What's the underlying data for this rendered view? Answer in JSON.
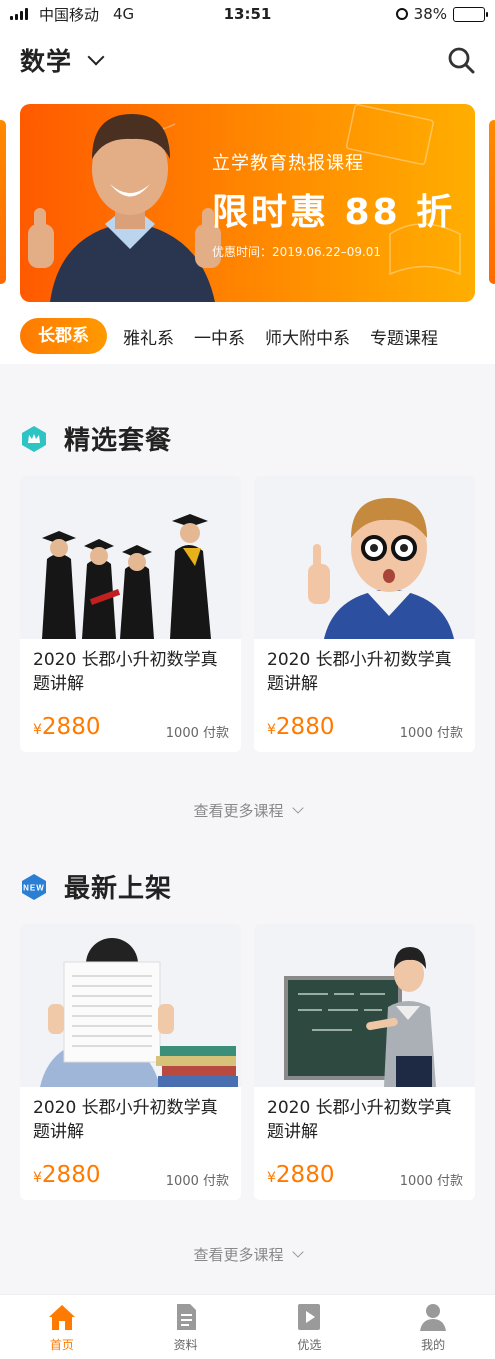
{
  "status_bar": {
    "carrier": "中国移动",
    "network": "4G",
    "time": "13:51",
    "battery": "38%",
    "battery_level": 0.38
  },
  "header": {
    "subject": "数学",
    "search_icon": "search-icon"
  },
  "banner": {
    "subtitle": "立学教育热报课程",
    "title": "限时惠 88 折",
    "date": "优惠时间：2019.06.22–09.01"
  },
  "tabs": [
    "长郡系",
    "雅礼系",
    "一中系",
    "师大附中系",
    "专题课程"
  ],
  "active_tab": 0,
  "featured": {
    "title": "精选套餐",
    "icon": "crown-icon",
    "cards": [
      {
        "title": "2020 长郡小升初数学真题讲解",
        "currency": "¥",
        "price": "2880",
        "paid": "1000 付款",
        "image": "graduates-photo"
      },
      {
        "title": "2020 长郡小升初数学真题讲解",
        "currency": "¥",
        "price": "2880",
        "paid": "1000 付款",
        "image": "boy-with-glasses-photo"
      }
    ],
    "more": "查看更多课程"
  },
  "newest": {
    "title": "最新上架",
    "icon": "new-badge-icon",
    "badge": "NEW",
    "cards": [
      {
        "title": "2020 长郡小升初数学真题讲解",
        "currency": "¥",
        "price": "2880",
        "paid": "1000 付款",
        "image": "student-with-test-paper-photo"
      },
      {
        "title": "2020 长郡小升初数学真题讲解",
        "currency": "¥",
        "price": "2880",
        "paid": "1000 付款",
        "image": "teacher-at-blackboard-photo"
      }
    ],
    "more": "查看更多课程"
  },
  "bottom_nav": [
    {
      "label": "首页",
      "icon": "home-icon",
      "active": true
    },
    {
      "label": "资料",
      "icon": "document-icon",
      "active": false
    },
    {
      "label": "优选",
      "icon": "video-book-icon",
      "active": false
    },
    {
      "label": "我的",
      "icon": "user-icon",
      "active": false
    }
  ],
  "colors": {
    "accent": "#ff7a00",
    "banner_start": "#ff5a00",
    "banner_end": "#ffae00",
    "teal": "#2ec4c4",
    "blue": "#2a7fd4"
  }
}
